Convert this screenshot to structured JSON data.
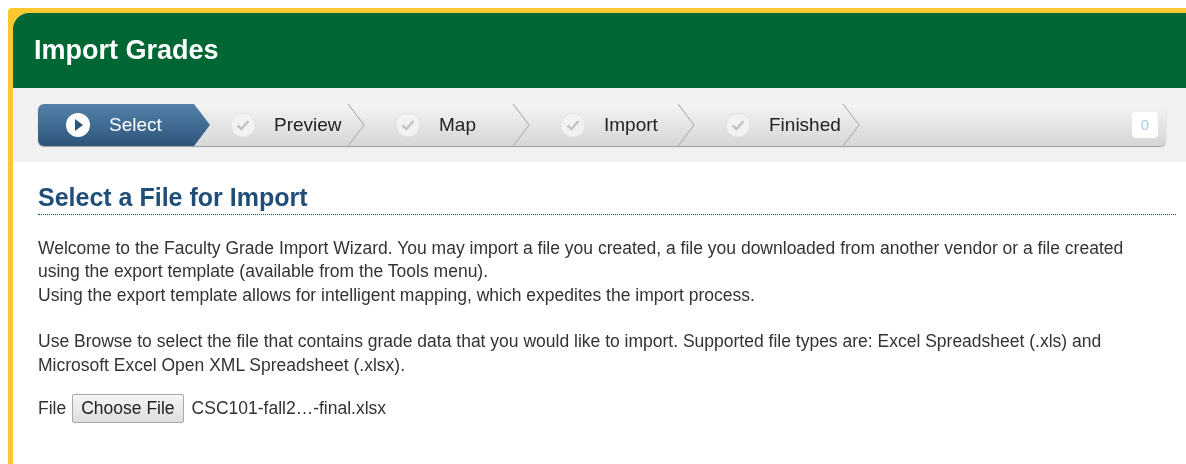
{
  "header": {
    "title": "Import Grades"
  },
  "steps": [
    {
      "label": "Select",
      "selected": true
    },
    {
      "label": "Preview",
      "selected": false
    },
    {
      "label": "Map",
      "selected": false
    },
    {
      "label": "Import",
      "selected": false
    },
    {
      "label": "Finished",
      "selected": false
    }
  ],
  "counter": "0",
  "section": {
    "heading": "Select a File for Import",
    "paragraphs": [
      [
        "Welcome to the Faculty Grade Import Wizard. You may import a file you created, a file you downloaded from another vendor or a file created using the export template (available from the Tools menu).",
        "Using the export template allows for intelligent mapping, which expedites the import process."
      ],
      [
        "Use Browse to select the file that contains grade data that you would like to import. Supported file types are: Excel Spreadsheet (.xls) and Microsoft Excel Open XML Spreadsheet (.xlsx)."
      ]
    ]
  },
  "file_field": {
    "label": "File",
    "button": "Choose File",
    "value": "CSC101-fall2…-final.xlsx"
  }
}
